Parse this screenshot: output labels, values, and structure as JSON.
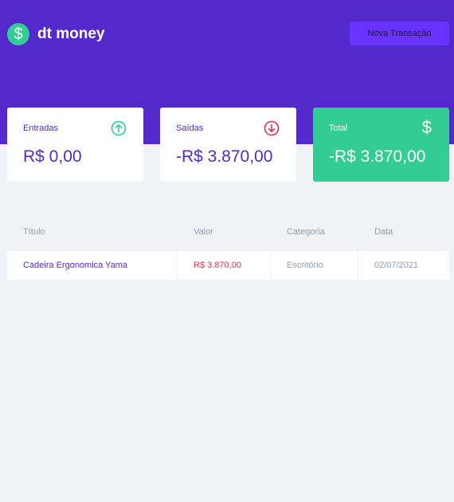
{
  "header": {
    "logo_symbol": "$",
    "app_name": "dt money",
    "new_transaction_label": "Nova Transação"
  },
  "summary": {
    "income": {
      "label": "Entradas",
      "value": "R$ 0,00",
      "icon": "arrow-up-circle-icon"
    },
    "outcome": {
      "label": "Saídas",
      "value": "-R$ 3.870,00",
      "icon": "arrow-down-circle-icon"
    },
    "total": {
      "label": "Total",
      "value": "-R$ 3.870,00",
      "icon": "dollar-icon",
      "symbol": "$"
    }
  },
  "table": {
    "columns": [
      "Título",
      "Valor",
      "Categoria",
      "Data"
    ],
    "rows": [
      {
        "title": "Cadeira Ergonomica Yama",
        "value": "R$ 3.870,00",
        "category": "Escritório",
        "date": "02/07/2021"
      }
    ]
  },
  "colors": {
    "brand": "#5429cc",
    "button": "#6933ff",
    "green": "#33cc95",
    "red": "#e52e4d",
    "muted": "#969cb2",
    "background": "#f0f2f5"
  }
}
